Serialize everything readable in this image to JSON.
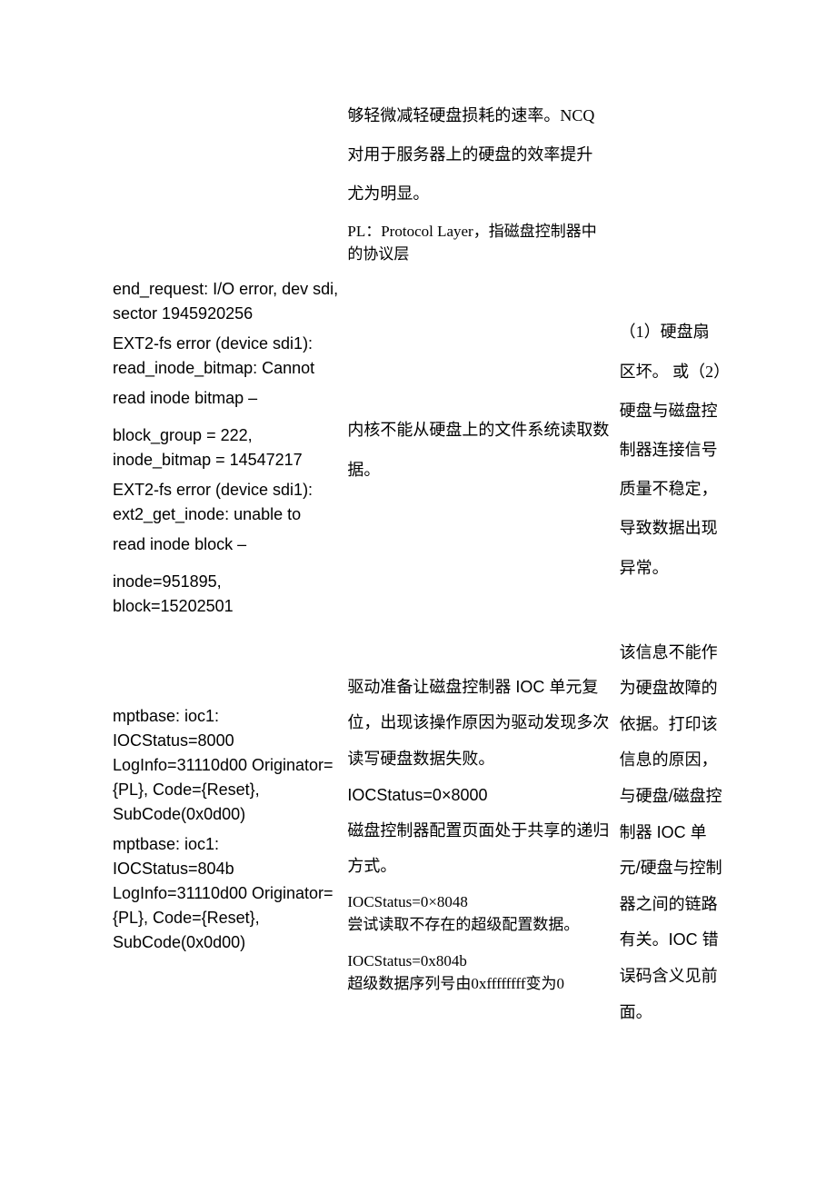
{
  "row1": {
    "log": "",
    "desc_p1": "够轻微减轻硬盘损耗的速率。NCQ",
    "desc_p2": "对用于服务器上的硬盘的效率提升",
    "desc_p3": "尤为明显。",
    "pl_note": "PL：Protocol Layer，指磁盘控制器中的协议层",
    "cause": ""
  },
  "row2": {
    "log_l1": "end_request: I/O error, dev sdi, sector 1945920256",
    "log_l2": "EXT2-fs error (device sdi1): read_inode_bitmap: Cannot",
    "log_l3": "read inode bitmap –",
    "log_l4": "block_group = 222, inode_bitmap = 14547217",
    "log_l5": "EXT2-fs error (device sdi1): ext2_get_inode: unable to",
    "log_l6": "read inode block –",
    "log_l7": "inode=951895, block=15202501",
    "desc": "内核不能从硬盘上的文件系统读取数据。",
    "cause": "（1）硬盘扇区坏。\n或（2）硬盘与磁盘控制器连接信号质量不稳定，导致数据出现异常。"
  },
  "row3": {
    "log_l1": "mptbase: ioc1: IOCStatus=8000 LogInfo=31110d00 Originator={PL}, Code={Reset}, SubCode(0x0d00)",
    "log_l2": "mptbase: ioc1: IOCStatus=804b LogInfo=31110d00 Originator={PL}, Code={Reset}, SubCode(0x0d00)",
    "desc_p1": "驱动准备让磁盘控制器 IOC 单元复位，出现该操作原因为驱动发现多次读写硬盘数据失败。",
    "desc_p2": "IOCStatus=0×8000",
    "desc_p3": "磁盘控制器配置页面处于共享的递归方式。",
    "desc_p4a": "IOCStatus=0×8048",
    "desc_p4b": "尝试读取不存在的超级配置数据。",
    "desc_p5a": "IOCStatus=0x804b",
    "desc_p5b": "超级数据序列号由0xffffffff变为0",
    "cause": "该信息不能作为硬盘故障的依据。打印该信息的原因，与硬盘/磁盘控制器 IOC 单元/硬盘与控制器之间的链路有关。IOC 错误码含义见前面。"
  }
}
